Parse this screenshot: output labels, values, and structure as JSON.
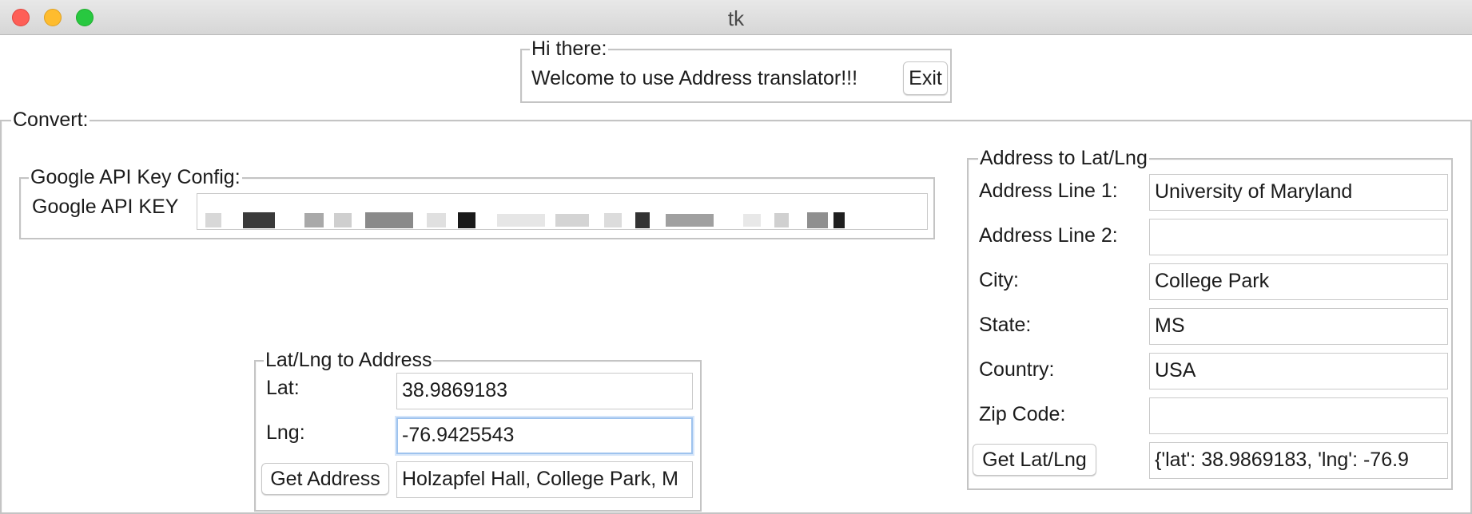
{
  "window": {
    "title": "tk"
  },
  "greeting": {
    "legend": "Hi there:",
    "message": "Welcome to use Address translator!!!",
    "exit_label": "Exit"
  },
  "convert": {
    "legend": "Convert:",
    "api_config": {
      "legend": "Google API Key Config:",
      "key_label": "Google API KEY",
      "key_value": ""
    },
    "latlng_to_address": {
      "legend": "Lat/Lng to Address",
      "lat_label": "Lat:",
      "lat_value": "38.9869183",
      "lng_label": "Lng:",
      "lng_value": "-76.9425543",
      "button_label": "Get Address",
      "result": "Holzapfel Hall, College Park, M"
    },
    "address_to_latlng": {
      "legend": "Address to Lat/Lng",
      "fields": [
        {
          "label": "Address Line 1:",
          "value": "University of Maryland"
        },
        {
          "label": "Address Line 2:",
          "value": ""
        },
        {
          "label": "City:",
          "value": "College Park"
        },
        {
          "label": "State:",
          "value": "MS"
        },
        {
          "label": "Country:",
          "value": "USA"
        },
        {
          "label": "Zip Code:",
          "value": ""
        }
      ],
      "button_label": "Get Lat/Lng",
      "result": "{'lat': 38.9869183, 'lng': -76.9"
    }
  },
  "colors": {
    "close": "#fe5f57",
    "minimize": "#febc2e",
    "maximize": "#28c840",
    "focus_ring": "#9ec3ee"
  }
}
